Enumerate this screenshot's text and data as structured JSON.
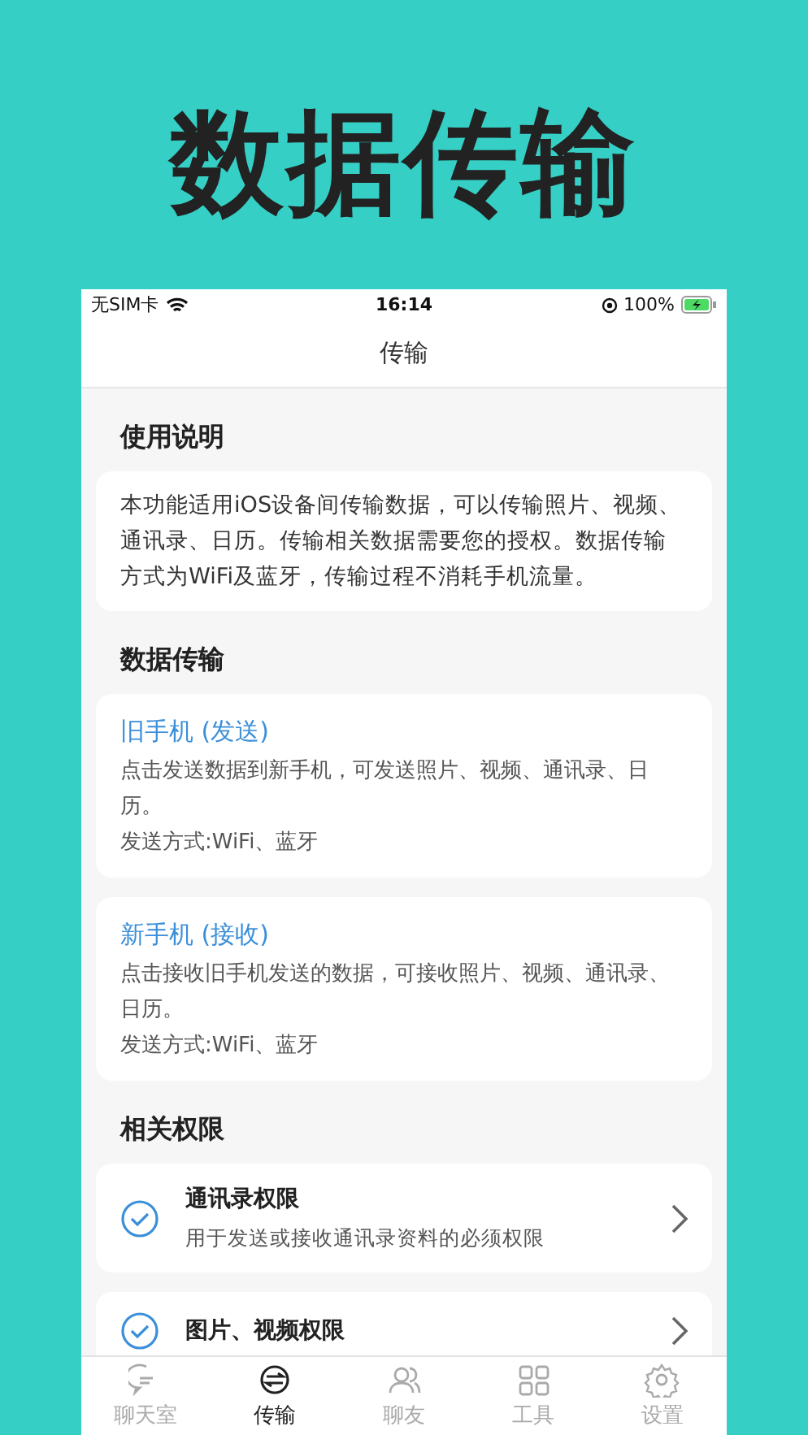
{
  "headline": "数据传输",
  "status_bar": {
    "carrier": "无SIM卡",
    "time": "16:14",
    "battery": "100%"
  },
  "nav": {
    "title": "传输"
  },
  "sections": [
    {
      "heading": "使用说明",
      "cards": [
        {
          "kind": "note",
          "text": "本功能适用iOS设备间传输数据，可以传输照片、视频、通讯录、日历。传输相关数据需要您的授权。数据传输方式为WiFi及蓝牙，传输过程不消耗手机流量。"
        }
      ]
    },
    {
      "heading": "数据传输",
      "cards": [
        {
          "kind": "transfer",
          "title": "旧手机 (发送)",
          "text": "点击发送数据到新手机，可发送照片、视频、通讯录、日历。",
          "method": "发送方式:WiFi、蓝牙"
        },
        {
          "kind": "transfer",
          "title": "新手机 (接收)",
          "text": "点击接收旧手机发送的数据，可接收照片、视频、通讯录、日历。",
          "method": "发送方式:WiFi、蓝牙"
        }
      ]
    },
    {
      "heading": "相关权限",
      "cards": [
        {
          "kind": "permission",
          "title": "通讯录权限",
          "text": "用于发送或接收通讯录资料的必须权限",
          "checked": true
        },
        {
          "kind": "permission",
          "title": "图片、视频权限",
          "checked": true
        }
      ]
    }
  ],
  "tabs": [
    {
      "label": "聊天室",
      "kind": "chat",
      "selected": false
    },
    {
      "label": "传输",
      "kind": "transfer",
      "selected": true
    },
    {
      "label": "聊友",
      "kind": "friends",
      "selected": false
    },
    {
      "label": "工具",
      "kind": "grid",
      "selected": false
    },
    {
      "label": "设置",
      "kind": "gear",
      "selected": false
    }
  ]
}
